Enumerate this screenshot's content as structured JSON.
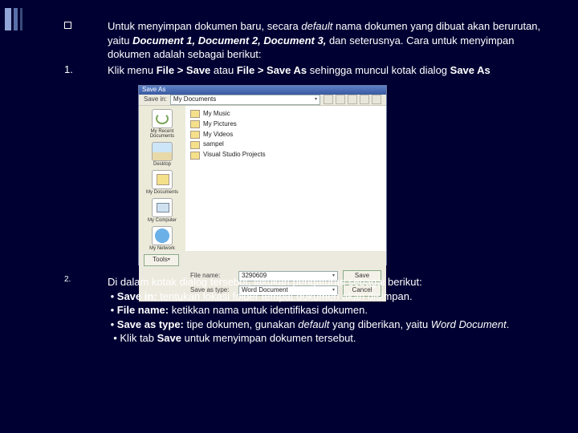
{
  "intro": {
    "pre": "Untuk menyimpan dokumen baru, secara ",
    "default": "default",
    "mid1": " nama dokumen yang dibuat akan berurutan, yaitu ",
    "d1": "Document 1,",
    "d2": " Document 2,",
    "d3": " Document 3,",
    "post": " dan seterusnya. Cara untuk menyimpan dokumen adalah sebagai berikut:"
  },
  "step1": {
    "num": "1.",
    "pre": "Klik menu ",
    "menu1": "File > Save",
    "mid": " atau ",
    "menu2": "File > Save As",
    "post": " sehingga muncul kotak dialog ",
    "dlg": "Save As"
  },
  "dialog": {
    "title": "Save As",
    "savein_lbl": "Save in:",
    "savein_val": "My Documents",
    "sidebar": {
      "recent": "My Recent Documents",
      "desktop": "Desktop",
      "mydocs": "My Documents",
      "mycomp": "My Computer",
      "mynet": "My Network"
    },
    "files": {
      "music": "My Music",
      "pics": "My Pictures",
      "videos": "My Videos",
      "sample": "sampel",
      "vsp": "Visual Studio Projects"
    },
    "filename_lbl": "File name:",
    "filename_val": "3290609",
    "saveas_lbl": "Save as type:",
    "saveas_val": "Word Document",
    "tools_btn": "Tools",
    "save_btn": "Save",
    "cancel_btn": "Cancel"
  },
  "step2": {
    "num": "2.",
    "intro": "Di dalam kotak dialog tersebut, lakukan pengaturan sebagai berikut:",
    "b1_lbl": "Save in:",
    "b1_txt": " tentukan lokasi folder tempat dokumen akan disimpan.",
    "b2_lbl": "File name:",
    "b2_txt": " ketikkan nama untuk identifikasi dokumen.",
    "b3_lbl": "Save as type:",
    "b3_mid1": " tipe dokumen, gunakan ",
    "b3_def": "default",
    "b3_mid2": " yang diberikan, yaitu ",
    "b3_wd": "Word Document",
    "b3_end": ".",
    "b4_pre": "Klik tab ",
    "b4_save": "Save",
    "b4_post": " untuk menyimpan dokumen tersebut."
  }
}
